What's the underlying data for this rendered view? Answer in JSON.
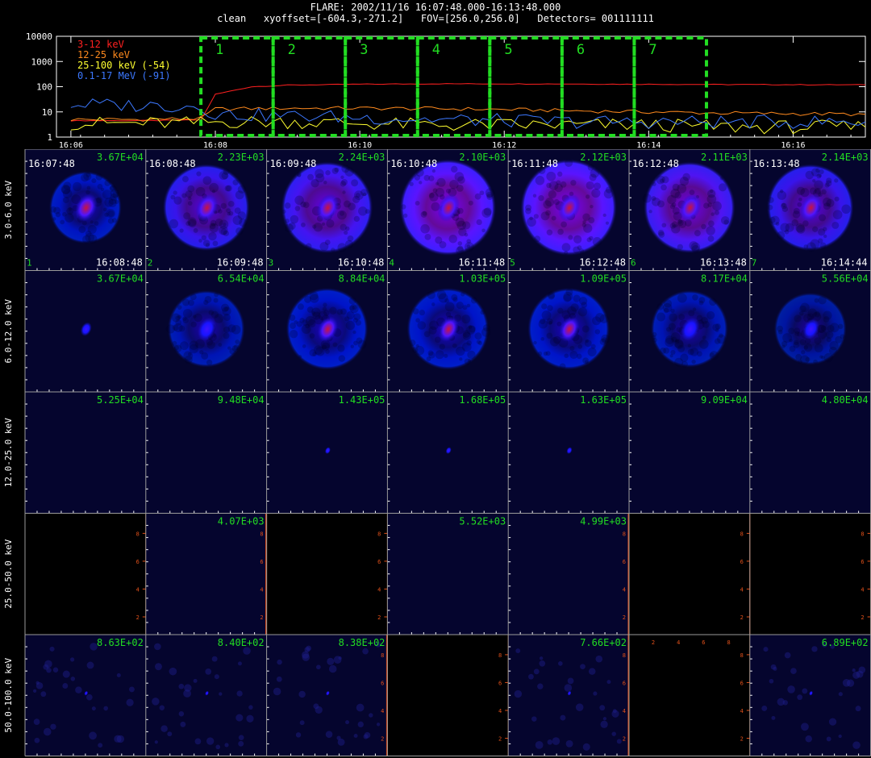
{
  "header": {
    "line1": "FLARE: 2002/11/16 16:07:48.000-16:13:48.000",
    "line2": "clean   xyoffset=[-604.3,-271.2]   FOV=[256.0,256.0]   Detectors= 001111111"
  },
  "chart_data": [
    {
      "type": "line",
      "yscale": "log",
      "ylim": [
        1,
        10000
      ],
      "y_ticks": [
        "10000",
        "1000",
        "100",
        "10",
        "1"
      ],
      "x_ticks": [
        "16:06",
        "16:08",
        "16:10",
        "16:12",
        "16:14",
        "16:16"
      ],
      "xlim": [
        "16:05:48",
        "16:17:00"
      ],
      "legend": [
        {
          "label": "3-12 keV",
          "color": "#ff2020"
        },
        {
          "label": "12-25 keV",
          "color": "#ff8a1e"
        },
        {
          "label": "25-100 keV (-54)",
          "color": "#ffff30"
        },
        {
          "label": "0.1-17 MeV (-91)",
          "color": "#3c78ff"
        }
      ],
      "series": [
        {
          "name": "3-12 keV",
          "color": "#ff2020",
          "x": [
            "16:06",
            "16:07",
            "16:07:48",
            "16:08",
            "16:08:30",
            "16:09",
            "16:10",
            "16:11",
            "16:12",
            "16:13",
            "16:14",
            "16:15",
            "16:16",
            "16:17"
          ],
          "values": [
            4.5,
            4.5,
            4.8,
            50,
            100,
            115,
            125,
            130,
            130,
            128,
            125,
            122,
            120,
            118
          ]
        },
        {
          "name": "12-25 keV",
          "color": "#ff8a1e",
          "x": [
            "16:06",
            "16:07",
            "16:07:48",
            "16:08",
            "16:09",
            "16:10",
            "16:11",
            "16:12",
            "16:13",
            "16:14",
            "16:15",
            "16:16",
            "16:17"
          ],
          "values": [
            5,
            5,
            5.5,
            13,
            14,
            14,
            13.5,
            12.5,
            11,
            10,
            9,
            8.5,
            8
          ]
        },
        {
          "name": "25-100 keV (-54)",
          "color": "#ffff30",
          "x": [
            "16:06",
            "16:07",
            "16:07:48",
            "16:08",
            "16:09",
            "16:10",
            "16:11",
            "16:12",
            "16:13",
            "16:14",
            "16:15",
            "16:16",
            "16:17"
          ],
          "values": [
            3.5,
            3.5,
            3.6,
            4,
            4,
            3.5,
            3,
            3,
            3,
            3,
            2.5,
            2.5,
            2.5
          ]
        },
        {
          "name": "0.1-17 MeV (-91)",
          "color": "#3c78ff",
          "x": [
            "16:06",
            "16:07",
            "16:07:48",
            "16:08",
            "16:09",
            "16:10",
            "16:11",
            "16:12",
            "16:13",
            "16:14",
            "16:15",
            "16:16",
            "16:17"
          ],
          "values": [
            20,
            18,
            17,
            8,
            7,
            6,
            5,
            4.5,
            4,
            4,
            4,
            4,
            4
          ]
        }
      ],
      "intervals": [
        {
          "label": "1",
          "start": "16:07:48",
          "end": "16:08:48"
        },
        {
          "label": "2",
          "start": "16:08:48",
          "end": "16:09:48"
        },
        {
          "label": "3",
          "start": "16:09:48",
          "end": "16:10:48"
        },
        {
          "label": "4",
          "start": "16:10:48",
          "end": "16:11:48"
        },
        {
          "label": "5",
          "start": "16:11:48",
          "end": "16:12:48"
        },
        {
          "label": "6",
          "start": "16:12:48",
          "end": "16:13:48"
        },
        {
          "label": "7",
          "start": "16:13:48",
          "end": "16:14:48"
        }
      ]
    },
    {
      "type": "heatmap",
      "row_labels": [
        "3.0-6.0 keV",
        "6.0-12.0 keV",
        "12.0-25.0 keV",
        "25.0-50.0 keV",
        "50.0-100.0 keV"
      ],
      "start_times": [
        "16:07:48",
        "16:08:48",
        "16:09:48",
        "16:10:48",
        "16:11:48",
        "16:12:48",
        "16:13:48"
      ],
      "end_times": [
        "16:08:48",
        "16:09:48",
        "16:10:48",
        "16:11:48",
        "16:12:48",
        "16:13:48",
        "16:14:44"
      ],
      "interval_numbers": [
        "1",
        "2",
        "3",
        "4",
        "5",
        "6",
        "7"
      ],
      "axis_ticks": [
        "2",
        "4",
        "6",
        "8"
      ],
      "cells": [
        [
          {
            "value": "3.67E+04",
            "intensity": 0.35,
            "core": 0.8,
            "ring": 0.55,
            "blob": 0.12,
            "ringR": 0.3,
            "mode": "img"
          },
          {
            "value": "2.23E+03",
            "intensity": 0.85,
            "core": 0.8,
            "ring": 0.85,
            "blob": 0.12,
            "ringR": 0.36,
            "mode": "img"
          },
          {
            "value": "2.24E+03",
            "intensity": 0.9,
            "core": 0.85,
            "ring": 0.9,
            "blob": 0.12,
            "ringR": 0.38,
            "mode": "img"
          },
          {
            "value": "2.10E+03",
            "intensity": 1.0,
            "core": 0.9,
            "ring": 1.0,
            "blob": 0.12,
            "ringR": 0.4,
            "mode": "img"
          },
          {
            "value": "2.12E+03",
            "intensity": 1.0,
            "core": 0.9,
            "ring": 1.0,
            "blob": 0.12,
            "ringR": 0.4,
            "mode": "img"
          },
          {
            "value": "2.11E+03",
            "intensity": 0.95,
            "core": 0.85,
            "ring": 0.9,
            "blob": 0.12,
            "ringR": 0.38,
            "mode": "img"
          },
          {
            "value": "2.14E+03",
            "intensity": 0.85,
            "core": 0.8,
            "ring": 0.85,
            "blob": 0.12,
            "ringR": 0.36,
            "mode": "img"
          }
        ],
        [
          {
            "value": "3.67E+04",
            "intensity": 0.3,
            "core": 0.6,
            "ring": 0.0,
            "blob": 0.06,
            "ringR": 0.0,
            "mode": "img"
          },
          {
            "value": "6.54E+04",
            "intensity": 0.5,
            "core": 0.65,
            "ring": 0.45,
            "blob": 0.1,
            "ringR": 0.32,
            "mode": "img"
          },
          {
            "value": "8.84E+04",
            "intensity": 0.6,
            "core": 0.85,
            "ring": 0.6,
            "blob": 0.11,
            "ringR": 0.34,
            "mode": "img"
          },
          {
            "value": "1.03E+05",
            "intensity": 0.6,
            "core": 0.8,
            "ring": 0.6,
            "blob": 0.11,
            "ringR": 0.34,
            "mode": "img"
          },
          {
            "value": "1.09E+05",
            "intensity": 0.6,
            "core": 0.8,
            "ring": 0.6,
            "blob": 0.11,
            "ringR": 0.34,
            "mode": "img"
          },
          {
            "value": "8.17E+04",
            "intensity": 0.5,
            "core": 0.65,
            "ring": 0.45,
            "blob": 0.1,
            "ringR": 0.32,
            "mode": "img"
          },
          {
            "value": "5.56E+04",
            "intensity": 0.4,
            "core": 0.55,
            "ring": 0.3,
            "blob": 0.09,
            "ringR": 0.3,
            "mode": "img"
          }
        ],
        [
          {
            "value": "5.25E+04",
            "intensity": 0.0,
            "core": 0.0,
            "ring": 0.0,
            "blob": 0.0,
            "ringR": 0.0,
            "mode": "img"
          },
          {
            "value": "9.48E+04",
            "intensity": 0.0,
            "core": 0.0,
            "ring": 0.0,
            "blob": 0.0,
            "ringR": 0.0,
            "mode": "img"
          },
          {
            "value": "1.43E+05",
            "intensity": 0.05,
            "core": 0.2,
            "ring": 0.0,
            "blob": 0.03,
            "ringR": 0.0,
            "mode": "img"
          },
          {
            "value": "1.68E+05",
            "intensity": 0.05,
            "core": 0.25,
            "ring": 0.0,
            "blob": 0.03,
            "ringR": 0.0,
            "mode": "img"
          },
          {
            "value": "1.63E+05",
            "intensity": 0.05,
            "core": 0.2,
            "ring": 0.0,
            "blob": 0.03,
            "ringR": 0.0,
            "mode": "img"
          },
          {
            "value": "9.09E+04",
            "intensity": 0.0,
            "core": 0.0,
            "ring": 0.0,
            "blob": 0.0,
            "ringR": 0.0,
            "mode": "img"
          },
          {
            "value": "4.80E+04",
            "intensity": 0.0,
            "core": 0.0,
            "ring": 0.0,
            "blob": 0.0,
            "ringR": 0.0,
            "mode": "img"
          }
        ],
        [
          {
            "value": "",
            "mode": "blank"
          },
          {
            "value": "4.07E+03",
            "intensity": 0.0,
            "core": 0.0,
            "ring": 0.0,
            "blob": 0.0,
            "ringR": 0.0,
            "mode": "img",
            "rightAxis": true
          },
          {
            "value": "",
            "mode": "blank"
          },
          {
            "value": "5.52E+03",
            "intensity": 0.0,
            "core": 0.0,
            "ring": 0.0,
            "blob": 0.0,
            "ringR": 0.0,
            "mode": "img"
          },
          {
            "value": "4.99E+03",
            "intensity": 0.0,
            "core": 0.0,
            "ring": 0.0,
            "blob": 0.0,
            "ringR": 0.0,
            "mode": "img",
            "rightAxis": true
          },
          {
            "value": "",
            "mode": "blank"
          },
          {
            "value": "",
            "mode": "blank"
          }
        ],
        [
          {
            "value": "8.63E+02",
            "intensity": 0.0,
            "core": 0.15,
            "ring": 0.0,
            "blob": 0.02,
            "ringR": 0.0,
            "mode": "img",
            "noise": true
          },
          {
            "value": "8.40E+02",
            "intensity": 0.0,
            "core": 0.1,
            "ring": 0.0,
            "blob": 0.02,
            "ringR": 0.0,
            "mode": "img",
            "noise": true
          },
          {
            "value": "8.38E+02",
            "intensity": 0.0,
            "core": 0.1,
            "ring": 0.0,
            "blob": 0.02,
            "ringR": 0.0,
            "mode": "img",
            "noise": true,
            "rightAxis": true
          },
          {
            "value": "",
            "mode": "blank"
          },
          {
            "value": "7.66E+02",
            "intensity": 0.0,
            "core": 0.1,
            "ring": 0.0,
            "blob": 0.02,
            "ringR": 0.0,
            "mode": "img",
            "noise": true,
            "rightAxis": true
          },
          {
            "value": "",
            "mode": "blank",
            "topAxis": true
          },
          {
            "value": "6.89E+02",
            "intensity": 0.0,
            "core": 0.1,
            "ring": 0.0,
            "blob": 0.02,
            "ringR": 0.0,
            "mode": "img",
            "noise": true
          }
        ]
      ]
    }
  ]
}
